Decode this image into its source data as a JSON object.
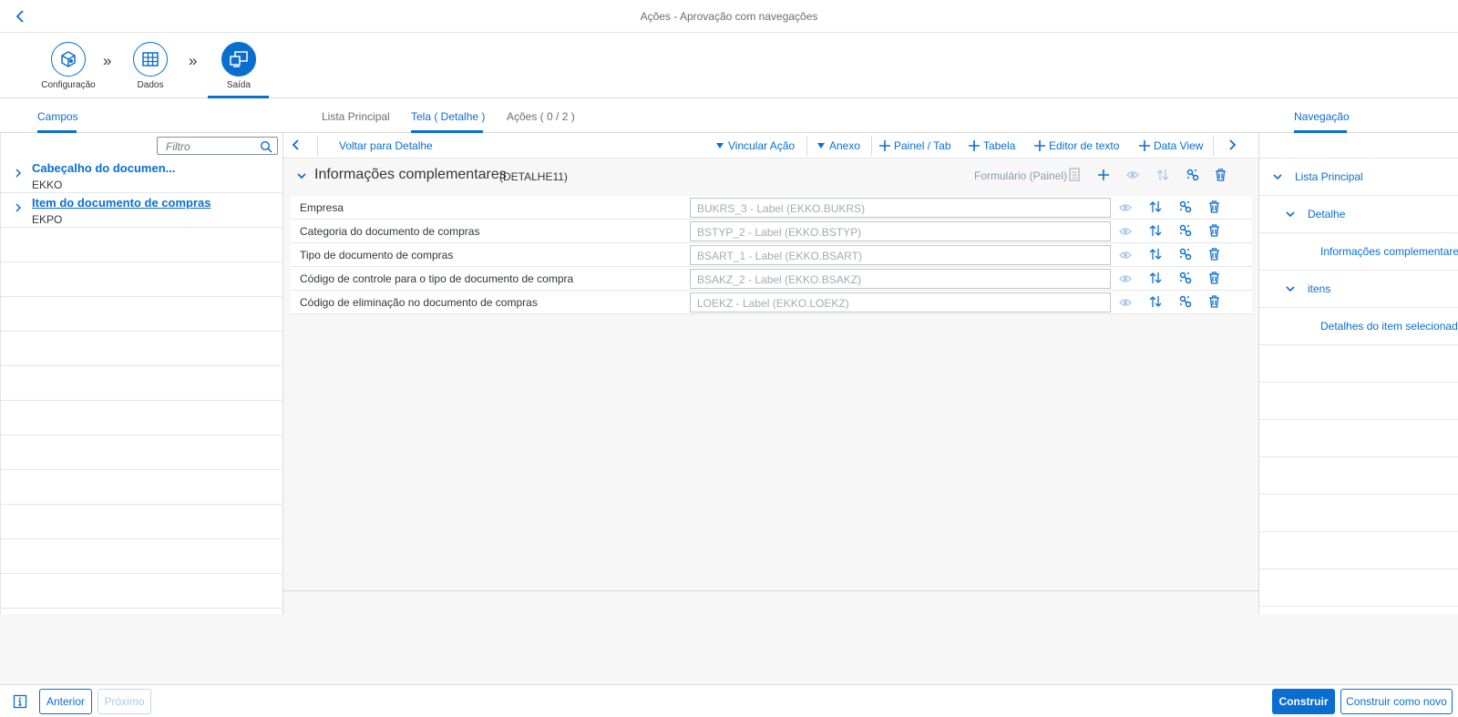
{
  "shell": {
    "title": "Ações - Aprovação com navegações"
  },
  "wizard": {
    "steps": [
      {
        "label": "Configuração",
        "icon": "cube-settings-icon"
      },
      {
        "label": "Dados",
        "icon": "table-grid-icon"
      },
      {
        "label": "Saída",
        "icon": "screen-output-icon"
      }
    ],
    "active_step": "Saída"
  },
  "tabs": {
    "left": "Campos",
    "center": [
      "Lista Principal",
      "Tela ( Detalhe )",
      "Ações ( 0 / 2 )"
    ],
    "center_selected": "Tela ( Detalhe )",
    "right": "Navegação"
  },
  "left": {
    "filter_placeholder": "Filtro",
    "items": [
      {
        "title": "Cabeçalho do documen...",
        "subtitle": "EKKO"
      },
      {
        "title": "Item do documento de compras",
        "subtitle": "EKPO"
      }
    ]
  },
  "toolbar": {
    "back_label": "Voltar para Detalhe",
    "vincular": "Vincular Ação",
    "anexo": "Anexo",
    "painel": "Painel / Tab",
    "tabela": "Tabela",
    "editor": "Editor de texto",
    "dataview": "Data View"
  },
  "panel": {
    "title": "Informações complementares",
    "id": "(DETALHE11)",
    "type_label": "Formulário (Painel)"
  },
  "fields": [
    {
      "label": "Empresa",
      "value": "BUKRS_3 - Label (EKKO.BUKRS)"
    },
    {
      "label": "Categoria do documento de compras",
      "value": "BSTYP_2 - Label (EKKO.BSTYP)"
    },
    {
      "label": "Tipo de documento de compras",
      "value": "BSART_1 - Label (EKKO.BSART)"
    },
    {
      "label": "Código de controle para o tipo de documento de compra",
      "value": "BSAKZ_2 - Label (EKKO.BSAKZ)"
    },
    {
      "label": "Código de eliminação no documento de compras",
      "value": "LOEKZ - Label (EKKO.LOEKZ)"
    }
  ],
  "navigation": {
    "items": [
      {
        "label": "Lista Principal",
        "level": 0
      },
      {
        "label": "Detalhe",
        "level": 1
      },
      {
        "label": "Informações complementares",
        "level": 2
      },
      {
        "label": "itens",
        "level": 1
      },
      {
        "label": "Detalhes do item selecionado",
        "level": 2
      }
    ]
  },
  "footer": {
    "info_icon": "info-icon",
    "anterior": "Anterior",
    "proximo": "Próximo",
    "construir": "Construir",
    "construir_novo": "Construir como novo"
  },
  "colors": {
    "accent": "#0a6ed1",
    "text": "#32363a",
    "muted": "#6a6d70"
  }
}
